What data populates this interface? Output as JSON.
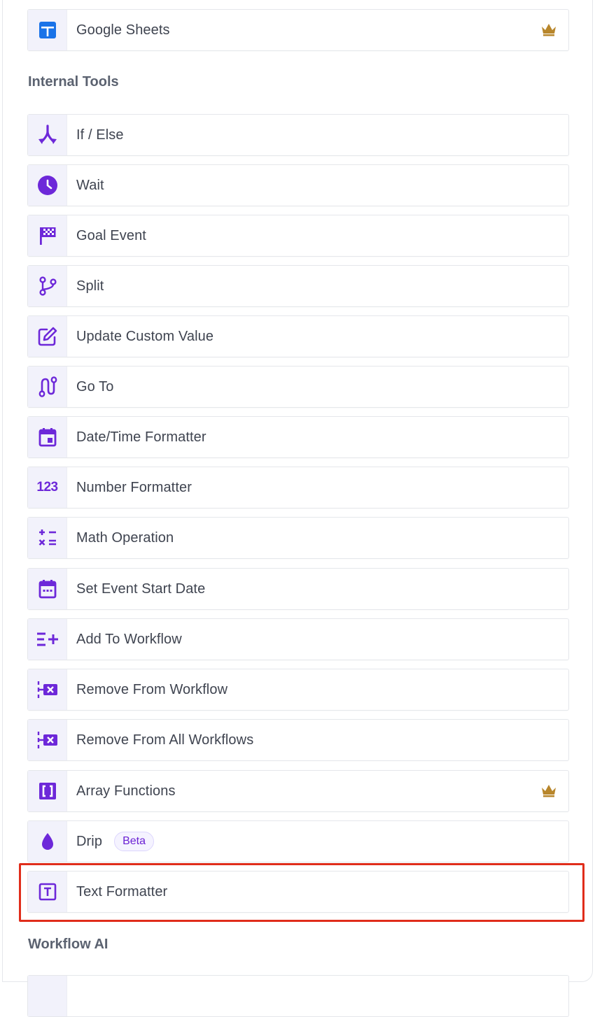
{
  "items_top": [
    {
      "label": "Google Sheets",
      "icon": "google-sheets-icon",
      "premium": true
    }
  ],
  "sections": {
    "internal_tools": "Internal Tools",
    "workflow_ai": "Workflow AI"
  },
  "internal_tools": [
    {
      "label": "If / Else",
      "icon": "branch-icon"
    },
    {
      "label": "Wait",
      "icon": "clock-icon"
    },
    {
      "label": "Goal Event",
      "icon": "checkered-flag-icon"
    },
    {
      "label": "Split",
      "icon": "git-branch-icon"
    },
    {
      "label": "Update Custom Value",
      "icon": "edit-square-icon"
    },
    {
      "label": "Go To",
      "icon": "route-icon"
    },
    {
      "label": "Date/Time Formatter",
      "icon": "calendar-icon"
    },
    {
      "label": "Number Formatter",
      "icon": "numbers-123-icon"
    },
    {
      "label": "Math Operation",
      "icon": "calculate-icon"
    },
    {
      "label": "Set Event Start Date",
      "icon": "calendar-dots-icon"
    },
    {
      "label": "Add To Workflow",
      "icon": "playlist-add-icon"
    },
    {
      "label": "Remove From Workflow",
      "icon": "remove-flow-icon"
    },
    {
      "label": "Remove From All Workflows",
      "icon": "remove-flow-icon"
    },
    {
      "label": "Array Functions",
      "icon": "brackets-icon",
      "premium": true
    },
    {
      "label": "Drip",
      "icon": "drop-icon",
      "badge": "Beta"
    },
    {
      "label": "Text Formatter",
      "icon": "text-box-icon"
    }
  ],
  "colors": {
    "accent": "#6d28d9",
    "premium": "#b8862b",
    "highlight": "#e02d1b",
    "sheets": "#1a73e8"
  }
}
